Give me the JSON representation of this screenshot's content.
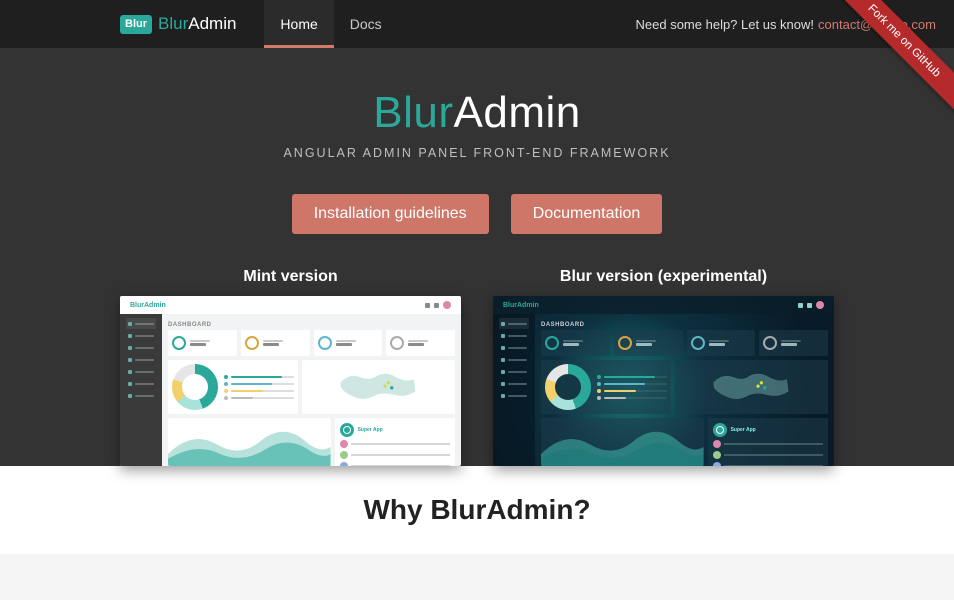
{
  "header": {
    "logo_badge": "Blur",
    "logo_accent": "Blur",
    "logo_rest": "Admin",
    "nav": [
      "Home",
      "Docs"
    ],
    "active_nav_index": 0,
    "help_text": "Need some help? Let us know!",
    "help_email": "contact@akveo.com"
  },
  "ribbon": "Fork me on GitHub",
  "hero": {
    "title_accent": "Blur",
    "title_rest": "Admin",
    "subtitle": "ANGULAR ADMIN PANEL FRONT-END FRAMEWORK",
    "buttons": [
      "Installation guidelines",
      "Documentation"
    ]
  },
  "versions": {
    "mint_label": "Mint version",
    "blur_label": "Blur version (experimental)"
  },
  "why_heading": "Why BlurAdmin?",
  "colors": {
    "accent_teal": "#2aa89a",
    "accent_salmon": "#ce7668",
    "dark_bg": "#333333",
    "header_bg": "#1f1f1f"
  }
}
